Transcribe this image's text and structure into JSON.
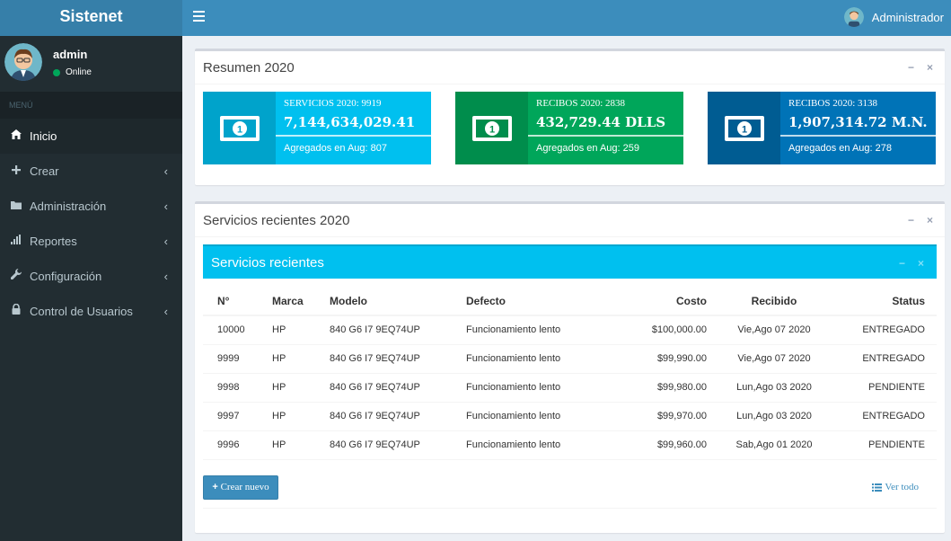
{
  "app": {
    "brand": "Sistenet"
  },
  "topbar": {
    "menu_toggle_icon": "hamburger-icon",
    "user_name": "Administrador"
  },
  "sidebar": {
    "user": {
      "name": "admin",
      "status": "Online",
      "status_color": "#00a65a"
    },
    "menu_header": "MENÚ",
    "items": [
      {
        "label": "Inicio",
        "icon": "home-icon",
        "active": true
      },
      {
        "label": "Crear",
        "icon": "plus-icon",
        "active": false
      },
      {
        "label": "Administración",
        "icon": "folder-icon",
        "active": false
      },
      {
        "label": "Reportes",
        "icon": "bar-chart-icon",
        "active": false
      },
      {
        "label": "Configuración",
        "icon": "wrench-icon",
        "active": false
      },
      {
        "label": "Control de Usuarios",
        "icon": "lock-icon",
        "active": false
      }
    ]
  },
  "summary": {
    "title": "Resumen 2020",
    "cards": [
      {
        "label": "SERVICIOS 2020: 9919",
        "value": "7,144,634,029.41",
        "desc": "Agregados en Aug: 807",
        "color": "#00c0ef",
        "icon_bg": "#00a3cb",
        "icon": "money-bill-icon"
      },
      {
        "label": "RECIBOS 2020: 2838",
        "value": "432,729.44 DLLS",
        "desc": "Agregados en Aug: 259",
        "color": "#00a65a",
        "icon_bg": "#008d4c",
        "icon": "money-bill-icon"
      },
      {
        "label": "RECIBOS 2020: 3138",
        "value": "1,907,314.72 M.N.",
        "desc": "Agregados en Aug: 278",
        "color": "#0073b7",
        "icon_bg": "#005c92",
        "icon": "money-bill-icon"
      }
    ]
  },
  "recent": {
    "title": "Servicios recientes 2020",
    "inner_title": "Servicios recientes",
    "columns": [
      "N°",
      "Marca",
      "Modelo",
      "Defecto",
      "Costo",
      "Recibido",
      "Status"
    ],
    "rows": [
      [
        "10000",
        "HP",
        "840 G6 I7 9EQ74UP",
        "Funcionamiento lento",
        "$100,000.00",
        "Vie,Ago 07 2020",
        "ENTREGADO"
      ],
      [
        "9999",
        "HP",
        "840 G6 I7 9EQ74UP",
        "Funcionamiento lento",
        "$99,990.00",
        "Vie,Ago 07 2020",
        "ENTREGADO"
      ],
      [
        "9998",
        "HP",
        "840 G6 I7 9EQ74UP",
        "Funcionamiento lento",
        "$99,980.00",
        "Lun,Ago 03 2020",
        "PENDIENTE"
      ],
      [
        "9997",
        "HP",
        "840 G6 I7 9EQ74UP",
        "Funcionamiento lento",
        "$99,970.00",
        "Lun,Ago 03 2020",
        "ENTREGADO"
      ],
      [
        "9996",
        "HP",
        "840 G6 I7 9EQ74UP",
        "Funcionamiento lento",
        "$99,960.00",
        "Sab,Ago 01 2020",
        "PENDIENTE"
      ]
    ],
    "create_button": "Crear nuevo",
    "view_all_link": "Ver todo"
  },
  "box_tools": {
    "collapse": "−",
    "close": "×"
  }
}
